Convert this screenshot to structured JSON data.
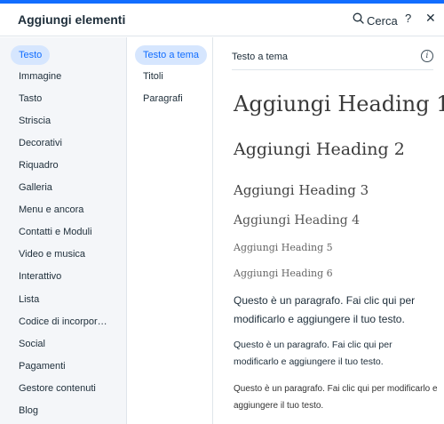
{
  "header": {
    "title": "Aggiungi elementi",
    "search_label": "Cerca",
    "help_label": "?",
    "close_label": "✕"
  },
  "categories": [
    {
      "label": "Testo",
      "selected": true
    },
    {
      "label": "Immagine"
    },
    {
      "label": "Tasto"
    },
    {
      "label": "Striscia"
    },
    {
      "label": "Decorativi"
    },
    {
      "label": "Riquadro"
    },
    {
      "label": "Galleria"
    },
    {
      "label": "Menu e ancora"
    },
    {
      "label": "Contatti e Moduli"
    },
    {
      "label": "Video e musica"
    },
    {
      "label": "Interattivo"
    },
    {
      "label": "Lista"
    },
    {
      "label": "Codice di incorpor…"
    },
    {
      "label": "Social"
    },
    {
      "label": "Pagamenti"
    },
    {
      "label": "Gestore contenuti"
    },
    {
      "label": "Blog"
    }
  ],
  "subcategories": [
    {
      "label": "Testo a tema",
      "selected": true
    },
    {
      "label": "Titoli"
    },
    {
      "label": "Paragrafi"
    }
  ],
  "main": {
    "section_title": "Testo a tema",
    "info_label": "i",
    "headings": [
      "Aggiungi Heading 1",
      "Aggiungi Heading 2",
      "Aggiungi Heading 3",
      "Aggiungi Heading 4",
      "Aggiungi Heading 5",
      "Aggiungi Heading 6"
    ],
    "paragraphs": [
      "Questo è un paragrafo. Fai clic qui per modificarlo e aggiungere il tuo testo.",
      "Questo è un paragrafo. Fai clic qui per modificarlo e aggiungere il tuo testo.",
      "Questo è un paragrafo. Fai clic qui per modificarlo e aggiungere il tuo testo."
    ]
  },
  "colors": {
    "accent": "#116dff",
    "selected_bg": "#d6e6fe",
    "sidebar_bg": "#f4f6f9"
  }
}
